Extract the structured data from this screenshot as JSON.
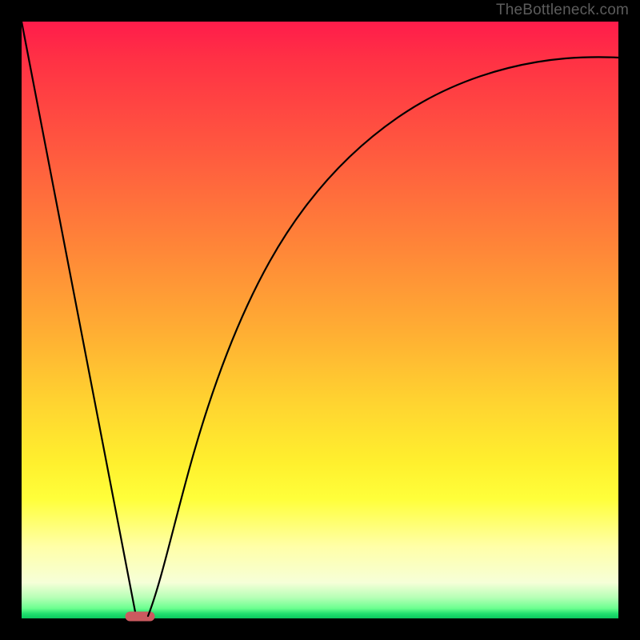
{
  "watermark": "TheBottleneck.com",
  "chart_data": {
    "type": "line",
    "title": "",
    "xlabel": "",
    "ylabel": "",
    "xlim": [
      0,
      100
    ],
    "ylim": [
      0,
      100
    ],
    "grid": false,
    "series": [
      {
        "name": "descending-line",
        "x": [
          0,
          19
        ],
        "values": [
          100,
          0
        ]
      },
      {
        "name": "rising-curve",
        "x": [
          21,
          25,
          30,
          35,
          40,
          45,
          50,
          55,
          60,
          65,
          70,
          75,
          80,
          85,
          90,
          95,
          100
        ],
        "values": [
          0,
          18,
          35,
          48,
          58,
          66,
          72,
          77,
          81,
          84,
          86.5,
          88.5,
          90,
          91.2,
          92.2,
          93,
          93.7
        ]
      }
    ],
    "marker": {
      "name": "bottleneck-minimum",
      "x_center": 20,
      "y": 0.2,
      "width_x": 4,
      "color": "#cc5a5f"
    },
    "background_gradient": {
      "top": "#ff1c4b",
      "upper_mid": "#ff8638",
      "mid": "#ffd430",
      "lower_mid": "#ffff3a",
      "near_bottom": "#f6ffd8",
      "bottom": "#0bc75e"
    }
  }
}
